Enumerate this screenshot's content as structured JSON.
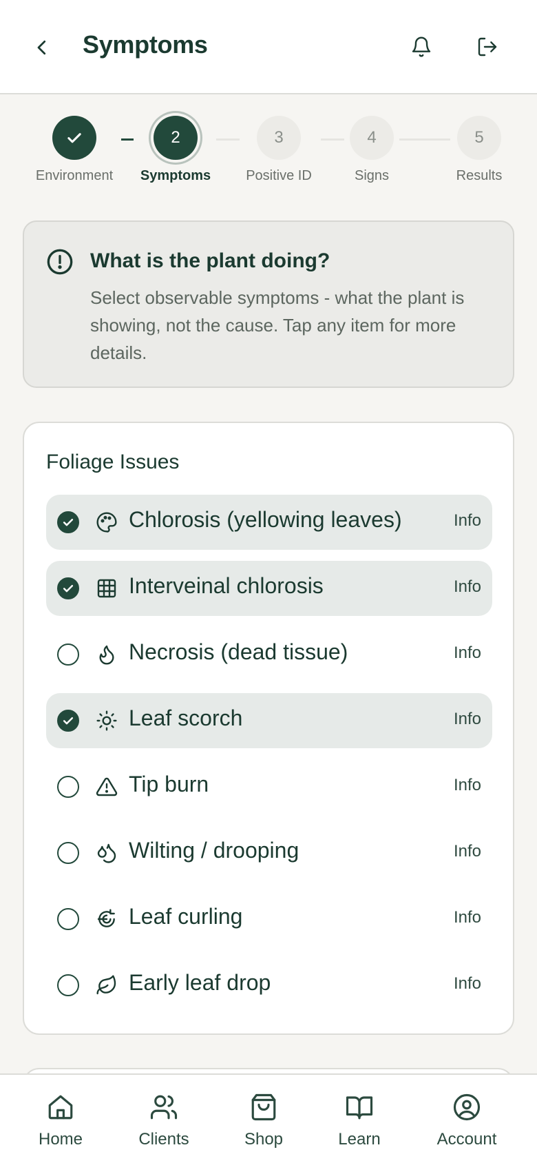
{
  "header": {
    "title": "Symptoms",
    "back_icon": "chevron-left-icon",
    "bell_icon": "bell-icon",
    "logout_icon": "logout-icon"
  },
  "stepper": {
    "steps": [
      {
        "number": "",
        "label": "Environment",
        "state": "done"
      },
      {
        "number": "2",
        "label": "Symptoms",
        "state": "current"
      },
      {
        "number": "3",
        "label": "Positive ID",
        "state": "pending"
      },
      {
        "number": "4",
        "label": "Signs",
        "state": "pending"
      },
      {
        "number": "5",
        "label": "Results",
        "state": "pending"
      }
    ]
  },
  "info": {
    "title": "What is the plant doing?",
    "text": "Select observable symptoms - what the plant is showing, not the cause. Tap any item for more details."
  },
  "foliage": {
    "title": "Foliage Issues",
    "items": [
      {
        "label": "Chlorosis (yellowing leaves)",
        "info": "Info",
        "selected": true,
        "icon": "palette-icon"
      },
      {
        "label": "Interveinal chlorosis",
        "info": "Info",
        "selected": true,
        "icon": "grid-icon"
      },
      {
        "label": "Necrosis (dead tissue)",
        "info": "Info",
        "selected": false,
        "icon": "flame-icon"
      },
      {
        "label": "Leaf scorch",
        "info": "Info",
        "selected": true,
        "icon": "sun-icon"
      },
      {
        "label": "Tip burn",
        "info": "Info",
        "selected": false,
        "icon": "warning-icon"
      },
      {
        "label": "Wilting / drooping",
        "info": "Info",
        "selected": false,
        "icon": "droplets-icon"
      },
      {
        "label": "Leaf curling",
        "info": "Info",
        "selected": false,
        "icon": "curl-icon"
      },
      {
        "label": "Early leaf drop",
        "info": "Info",
        "selected": false,
        "icon": "leaf-icon"
      }
    ]
  },
  "nav": {
    "items": [
      {
        "label": "Home",
        "icon": "home-icon"
      },
      {
        "label": "Clients",
        "icon": "users-icon"
      },
      {
        "label": "Shop",
        "icon": "shopping-bag-icon"
      },
      {
        "label": "Learn",
        "icon": "book-icon"
      },
      {
        "label": "Account",
        "icon": "user-circle-icon"
      }
    ]
  },
  "colors": {
    "primary": "#22493b",
    "background": "#f6f5f2",
    "selected_row": "#e6eae8"
  }
}
